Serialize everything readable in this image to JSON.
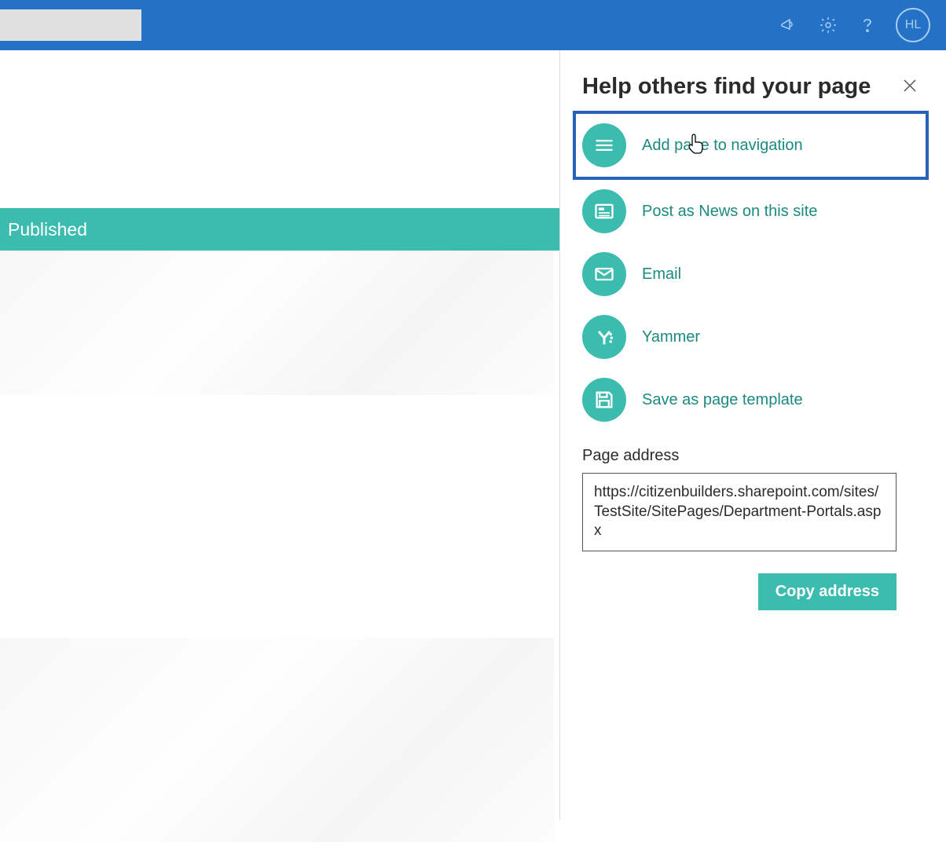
{
  "header": {
    "avatar_initials": "HL"
  },
  "content": {
    "published_label": "Published"
  },
  "panel": {
    "title": "Help others find your page",
    "options": [
      {
        "id": "add-nav",
        "label": "Add page to navigation",
        "icon": "hamburger-icon"
      },
      {
        "id": "post-news",
        "label": "Post as News on this site",
        "icon": "news-icon"
      },
      {
        "id": "email",
        "label": "Email",
        "icon": "mail-icon"
      },
      {
        "id": "yammer",
        "label": "Yammer",
        "icon": "yammer-icon"
      },
      {
        "id": "save-template",
        "label": "Save as page template",
        "icon": "save-icon"
      }
    ],
    "page_address_label": "Page address",
    "page_address_value": "https://citizenbuilders.sharepoint.com/sites/TestSite/SitePages/Department-Portals.aspx",
    "copy_label": "Copy address"
  }
}
